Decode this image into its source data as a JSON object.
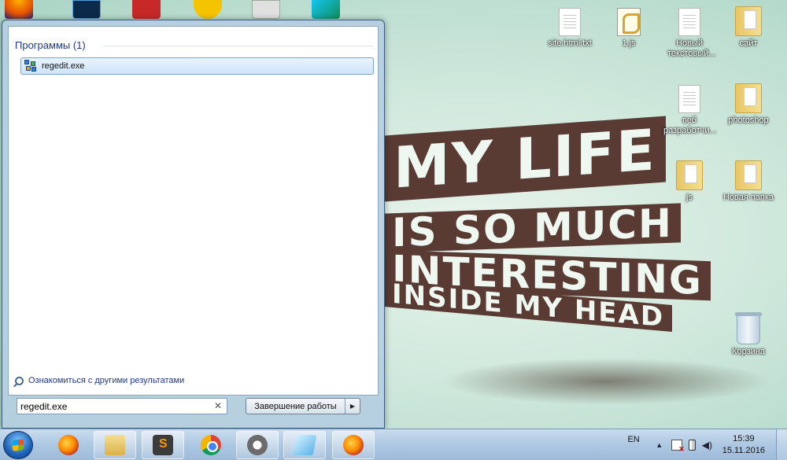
{
  "desktop": {
    "wallpaper_lines": [
      "MY LIFE",
      "IS SO MUCH",
      "INTERESTING",
      "INSIDE MY HEAD"
    ],
    "icons": [
      {
        "label": "site.html.txt",
        "icon": "text-document-icon"
      },
      {
        "label": "1.js",
        "icon": "script-file-icon"
      },
      {
        "label": "Новый текстовый...",
        "icon": "text-document-icon"
      },
      {
        "label": "сайт",
        "icon": "folder-icon"
      },
      {
        "label": "веб разработчи...",
        "icon": "text-document-icon"
      },
      {
        "label": "photoshop",
        "icon": "folder-icon"
      },
      {
        "label": "js",
        "icon": "folder-icon"
      },
      {
        "label": "Новая папка",
        "icon": "folder-icon"
      },
      {
        "label": "Корзина",
        "icon": "recycle-bin-icon"
      }
    ]
  },
  "start_menu": {
    "section_title": "Программы (1)",
    "results": [
      {
        "label": "regedit.exe",
        "icon": "regedit-icon"
      }
    ],
    "more_results": "Ознакомиться с другими результатами",
    "search": {
      "value": "regedit.exe"
    },
    "shutdown_label": "Завершение работы"
  },
  "taskbar": {
    "apps": [
      {
        "name": "firefox",
        "icon": "firefox-icon"
      },
      {
        "name": "explorer",
        "icon": "file-explorer-icon"
      },
      {
        "name": "sublime",
        "icon": "sublime-text-icon"
      },
      {
        "name": "chrome",
        "icon": "chrome-icon"
      },
      {
        "name": "app",
        "icon": "app-icon"
      },
      {
        "name": "notepad",
        "icon": "notepad-icon"
      },
      {
        "name": "firefox2",
        "icon": "firefox-icon"
      }
    ],
    "tray": {
      "language": "EN",
      "time": "15:39",
      "date": "15.11.2016"
    }
  }
}
